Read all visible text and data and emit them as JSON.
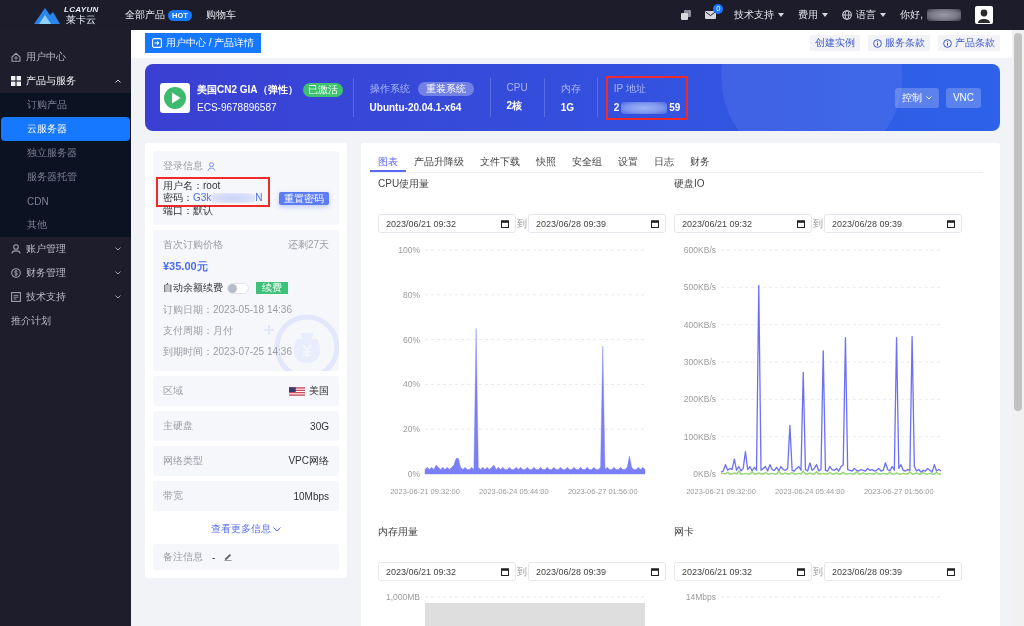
{
  "top_bar": {
    "logo_text": "LCAYUN",
    "logo_subtext": "莱卡云",
    "nav": [
      {
        "label": "全部产品",
        "badge": "HOT"
      },
      {
        "label": "购物车"
      }
    ],
    "mail_count": "0",
    "menus": [
      {
        "label": "技术支持",
        "kind": "dropdown"
      },
      {
        "label": "费用",
        "kind": "dropdown"
      },
      {
        "label": "语言",
        "kind": "language"
      }
    ],
    "greeting": "你好,",
    "name_redacted": true
  },
  "sidebar": {
    "items": [
      {
        "label": "用户中心",
        "kind": "link",
        "selected": false
      },
      {
        "label": "产品与服务",
        "kind": "group",
        "selected": false,
        "expanded": true,
        "children": [
          {
            "label": "订购产品",
            "selected": false
          },
          {
            "label": "云服务器",
            "selected": true
          },
          {
            "label": "独立服务器",
            "selected": false
          },
          {
            "label": "服务器托管",
            "selected": false
          },
          {
            "label": "CDN",
            "selected": false
          },
          {
            "label": "其他",
            "selected": false
          }
        ]
      },
      {
        "label": "账户管理",
        "kind": "group",
        "selected": false,
        "expanded": false
      },
      {
        "label": "财务管理",
        "kind": "group",
        "selected": false,
        "expanded": false
      },
      {
        "label": "技术支持",
        "kind": "group",
        "selected": false,
        "expanded": false
      },
      {
        "label": "推介计划",
        "kind": "link",
        "selected": false
      }
    ]
  },
  "header": {
    "breadcrumb": "用户中心 / 产品详情",
    "links": [
      {
        "label": "创建实例",
        "kind": "plain"
      },
      {
        "label": "服务条款",
        "kind": "info"
      },
      {
        "label": "产品条款",
        "kind": "info"
      }
    ]
  },
  "product": {
    "name": "美国CN2 GIA（弹性）",
    "status": "已激活",
    "id": "ECS-9678896587",
    "specs": [
      {
        "label": "操作系统",
        "action": "重装系统",
        "value": "Ubuntu-20.04.1-x64"
      },
      {
        "label": "CPU",
        "value": "2核"
      },
      {
        "label": "内存",
        "value": "1G"
      },
      {
        "label": "IP 地址",
        "value": "2",
        "value_end": "59",
        "redacted": true,
        "highlighted": true
      }
    ],
    "buttons": [
      {
        "label": "控制",
        "kind": "dropdown"
      },
      {
        "label": "VNC",
        "kind": "plain"
      }
    ]
  },
  "login": {
    "title": "登录信息",
    "highlighted": true,
    "username_label": "用户名：",
    "username": "root",
    "password_label": "密码：",
    "password": "G3k",
    "password_end": "N",
    "redacted": true,
    "port": "端口：默认",
    "reset_button": "重置密码"
  },
  "billing": {
    "price_label": "首次订购价格",
    "remaining": "还剩27天",
    "price": "¥35.00元",
    "auto_renew_label": "自动余额续费",
    "auto_renew": false,
    "renew_button": "续费",
    "details": [
      "订购日期：2023-05-18 14:36",
      "支付周期：月付",
      "到期时间：2023-07-25 14:36"
    ]
  },
  "info_rows": [
    {
      "label": "区域",
      "value": "美国",
      "kind": "region"
    },
    {
      "label": "主硬盘",
      "value": "30G",
      "kind": "plain"
    },
    {
      "label": "网络类型",
      "value": "VPC网络",
      "kind": "plain"
    },
    {
      "label": "带宽",
      "value": "10Mbps",
      "kind": "plain"
    }
  ],
  "more_link": "查看更多信息",
  "notes": {
    "label": "备注信息",
    "value": "-"
  },
  "tabs": [
    {
      "label": "图表",
      "selected": true
    },
    {
      "label": "产品升降级",
      "selected": false
    },
    {
      "label": "文件下载",
      "selected": false
    },
    {
      "label": "快照",
      "selected": false
    },
    {
      "label": "安全组",
      "selected": false
    },
    {
      "label": "设置",
      "selected": false
    },
    {
      "label": "日志",
      "selected": false
    },
    {
      "label": "财务",
      "selected": false
    }
  ],
  "charts": [
    {
      "title": "CPU使用量",
      "from": "2023/06/21 09:32",
      "to_label": "到",
      "to": "2023/06/28 09:39",
      "kind": "plot",
      "chart_data": {
        "type": "area",
        "grid": true,
        "ylim": [
          0,
          100
        ],
        "yticks": [
          {
            "value": 0,
            "label": "0%"
          },
          {
            "value": 20,
            "label": "20%"
          },
          {
            "value": 40,
            "label": "40%"
          },
          {
            "value": 60,
            "label": "60%"
          },
          {
            "value": 80,
            "label": "80%"
          },
          {
            "value": 100,
            "label": "100%"
          }
        ],
        "categories": [
          "2023-06-21 09:32:00",
          null,
          null,
          null,
          null,
          null,
          null,
          null,
          null,
          null,
          null,
          null,
          null,
          null,
          null,
          null,
          null,
          null,
          null,
          null,
          null,
          null,
          null,
          null,
          null,
          null,
          null,
          null,
          null,
          null,
          null,
          null,
          null,
          null,
          null,
          null,
          null,
          null,
          null,
          null,
          "2023-06-24 05:44:00",
          null,
          null,
          null,
          null,
          null,
          null,
          null,
          null,
          null,
          null,
          null,
          null,
          null,
          null,
          null,
          null,
          null,
          null,
          null,
          null,
          null,
          null,
          null,
          null,
          null,
          null,
          null,
          null,
          null,
          null,
          null,
          null,
          null,
          null,
          null,
          null,
          null,
          null,
          null,
          "2023-06-27 01:56:00",
          null,
          null,
          null,
          null,
          null,
          null,
          null,
          null,
          null,
          null,
          null,
          null,
          null,
          null,
          null,
          null,
          null,
          null,
          null
        ],
        "values": [
          2,
          3,
          2,
          3,
          2,
          4,
          3,
          2,
          3,
          2,
          3,
          2,
          3,
          4,
          7,
          7,
          3,
          2,
          3,
          2,
          2,
          3,
          2,
          65,
          3,
          2,
          3,
          2,
          3,
          2,
          3,
          4,
          2,
          3,
          2,
          3,
          2,
          2,
          3,
          2,
          2,
          3,
          2,
          3,
          2,
          2,
          3,
          2,
          2,
          3,
          2,
          2,
          3,
          2,
          2,
          3,
          2,
          2,
          3,
          2,
          2,
          3,
          2,
          2,
          3,
          2,
          2,
          3,
          2,
          2,
          3,
          2,
          2,
          3,
          2,
          2,
          3,
          2,
          2,
          3,
          57,
          2,
          3,
          2,
          2,
          3,
          2,
          2,
          3,
          2,
          2,
          3,
          8,
          3,
          2,
          2,
          3,
          2,
          3,
          2
        ]
      }
    },
    {
      "title": "硬盘IO",
      "from": "2023/06/21 09:32",
      "to_label": "到",
      "to": "2023/06/28 09:39",
      "kind": "plot",
      "chart_data": {
        "type": "line",
        "grid": true,
        "ylim": [
          0,
          600
        ],
        "yticks": [
          {
            "value": 0,
            "label": "0KB/s"
          },
          {
            "value": 100,
            "label": "100KB/s"
          },
          {
            "value": 200,
            "label": "200KB/s"
          },
          {
            "value": 300,
            "label": "300KB/s"
          },
          {
            "value": 400,
            "label": "400KB/s"
          },
          {
            "value": 500,
            "label": "500KB/s"
          },
          {
            "value": 600,
            "label": "600KB/s"
          }
        ],
        "categories": [
          "2023-06-21 09:32:00",
          null,
          null,
          null,
          null,
          null,
          null,
          null,
          null,
          null,
          null,
          null,
          null,
          null,
          null,
          null,
          null,
          null,
          null,
          null,
          null,
          null,
          null,
          null,
          null,
          null,
          null,
          null,
          null,
          null,
          null,
          null,
          null,
          null,
          null,
          null,
          null,
          null,
          null,
          null,
          "2023-06-24 05:44:00",
          null,
          null,
          null,
          null,
          null,
          null,
          null,
          null,
          null,
          null,
          null,
          null,
          null,
          null,
          null,
          null,
          null,
          null,
          null,
          null,
          null,
          null,
          null,
          null,
          null,
          null,
          null,
          null,
          null,
          null,
          null,
          null,
          null,
          null,
          null,
          null,
          null,
          null,
          null,
          "2023-06-27 01:56:00",
          null,
          null,
          null,
          null,
          null,
          null,
          null,
          null,
          null,
          null,
          null,
          null,
          null,
          null,
          null,
          null,
          null,
          null,
          null
        ],
        "series": [
          {
            "color": "#6b70f5",
            "values": [
              5,
              8,
              25,
              10,
              15,
              12,
              40,
              10,
              20,
              8,
              15,
              60,
              12,
              20,
              8,
              18,
              10,
              505,
              10,
              15,
              20,
              8,
              25,
              12,
              10,
              18,
              8,
              20,
              12,
              10,
              15,
              130,
              10,
              8,
              15,
              20,
              10,
              272,
              12,
              8,
              30,
              10,
              15,
              25,
              8,
              12,
              330,
              10,
              8,
              20,
              12,
              10,
              15,
              8,
              20,
              25,
              365,
              12,
              10,
              8,
              15,
              10,
              8,
              12,
              10,
              8,
              15,
              10,
              12,
              8,
              10,
              15,
              8,
              10,
              30,
              12,
              8,
              20,
              10,
              365,
              15,
              25,
              10,
              8,
              12,
              10,
              368,
              20,
              8,
              12,
              5,
              10,
              8,
              15,
              10,
              5,
              25,
              8,
              12,
              8
            ]
          },
          {
            "color": "#8fd46c",
            "values": [
              0,
              2,
              0,
              5,
              0,
              0,
              3,
              0,
              8,
              0,
              0,
              2,
              0,
              0,
              6,
              0,
              0,
              3,
              0,
              0,
              4,
              0,
              0,
              2,
              0,
              0,
              7,
              0,
              0,
              3,
              0,
              0,
              5,
              0,
              0,
              2,
              0,
              8,
              0,
              0,
              3,
              0,
              0,
              6,
              0,
              0,
              2,
              0,
              0,
              4,
              0,
              0,
              3,
              0,
              0,
              5,
              0,
              0,
              2,
              0,
              0,
              6,
              0,
              0,
              3,
              0,
              0,
              2,
              0,
              0,
              4,
              0,
              0,
              2,
              0,
              0,
              5,
              0,
              0,
              3,
              0,
              0,
              2,
              0,
              0,
              6,
              0,
              0,
              3,
              0,
              0,
              4,
              0,
              0,
              2,
              0,
              0,
              5,
              0,
              0
            ]
          }
        ]
      }
    },
    {
      "title": "内存用量",
      "from": "2023/06/21 09:32",
      "to_label": "到",
      "to": "2023/06/28 09:39",
      "kind": "placeholder",
      "top_tick": "1,000MB"
    },
    {
      "title": "网卡",
      "from": "2023/06/21 09:32",
      "to_label": "到",
      "to": "2023/06/28 09:39",
      "kind": "blank",
      "top_tick": "14Mbps"
    }
  ]
}
